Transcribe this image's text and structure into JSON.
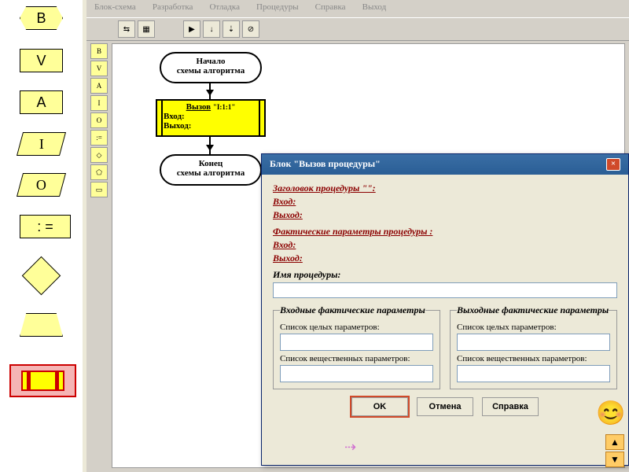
{
  "palette": {
    "b": "B",
    "v": "V",
    "a": "A",
    "i": "I",
    "o": "O",
    "assign": ": ="
  },
  "menu": {
    "m1": "Блок-схема",
    "m2": "Разработка",
    "m3": "Отладка",
    "m4": "Процедуры",
    "m5": "Справка",
    "m6": "Выход"
  },
  "flow": {
    "start_l1": "Начало",
    "start_l2": "схемы алгоритма",
    "call_title": "Вызов",
    "call_id": "\"I:1:1\"",
    "call_in": "Вход:",
    "call_out": "Выход:",
    "end_l1": "Конец",
    "end_l2": "схемы алгоритма"
  },
  "dialog": {
    "title": "Блок  \"Вызов процедуры\"",
    "hdr1": "Заголовок процедуры \"\":",
    "in": "Вход:",
    "out": "Выход:",
    "hdr2": "Фактические параметры процедуры :",
    "name_lbl": "Имя процедуры:",
    "grp_in": "Входные фактические параметры",
    "grp_out": "Выходные фактические параметры",
    "int_lbl": "Список целых параметров:",
    "real_lbl": "Список вещественных параметров:",
    "ok": "OK",
    "cancel": "Отмена",
    "help": "Справка"
  }
}
